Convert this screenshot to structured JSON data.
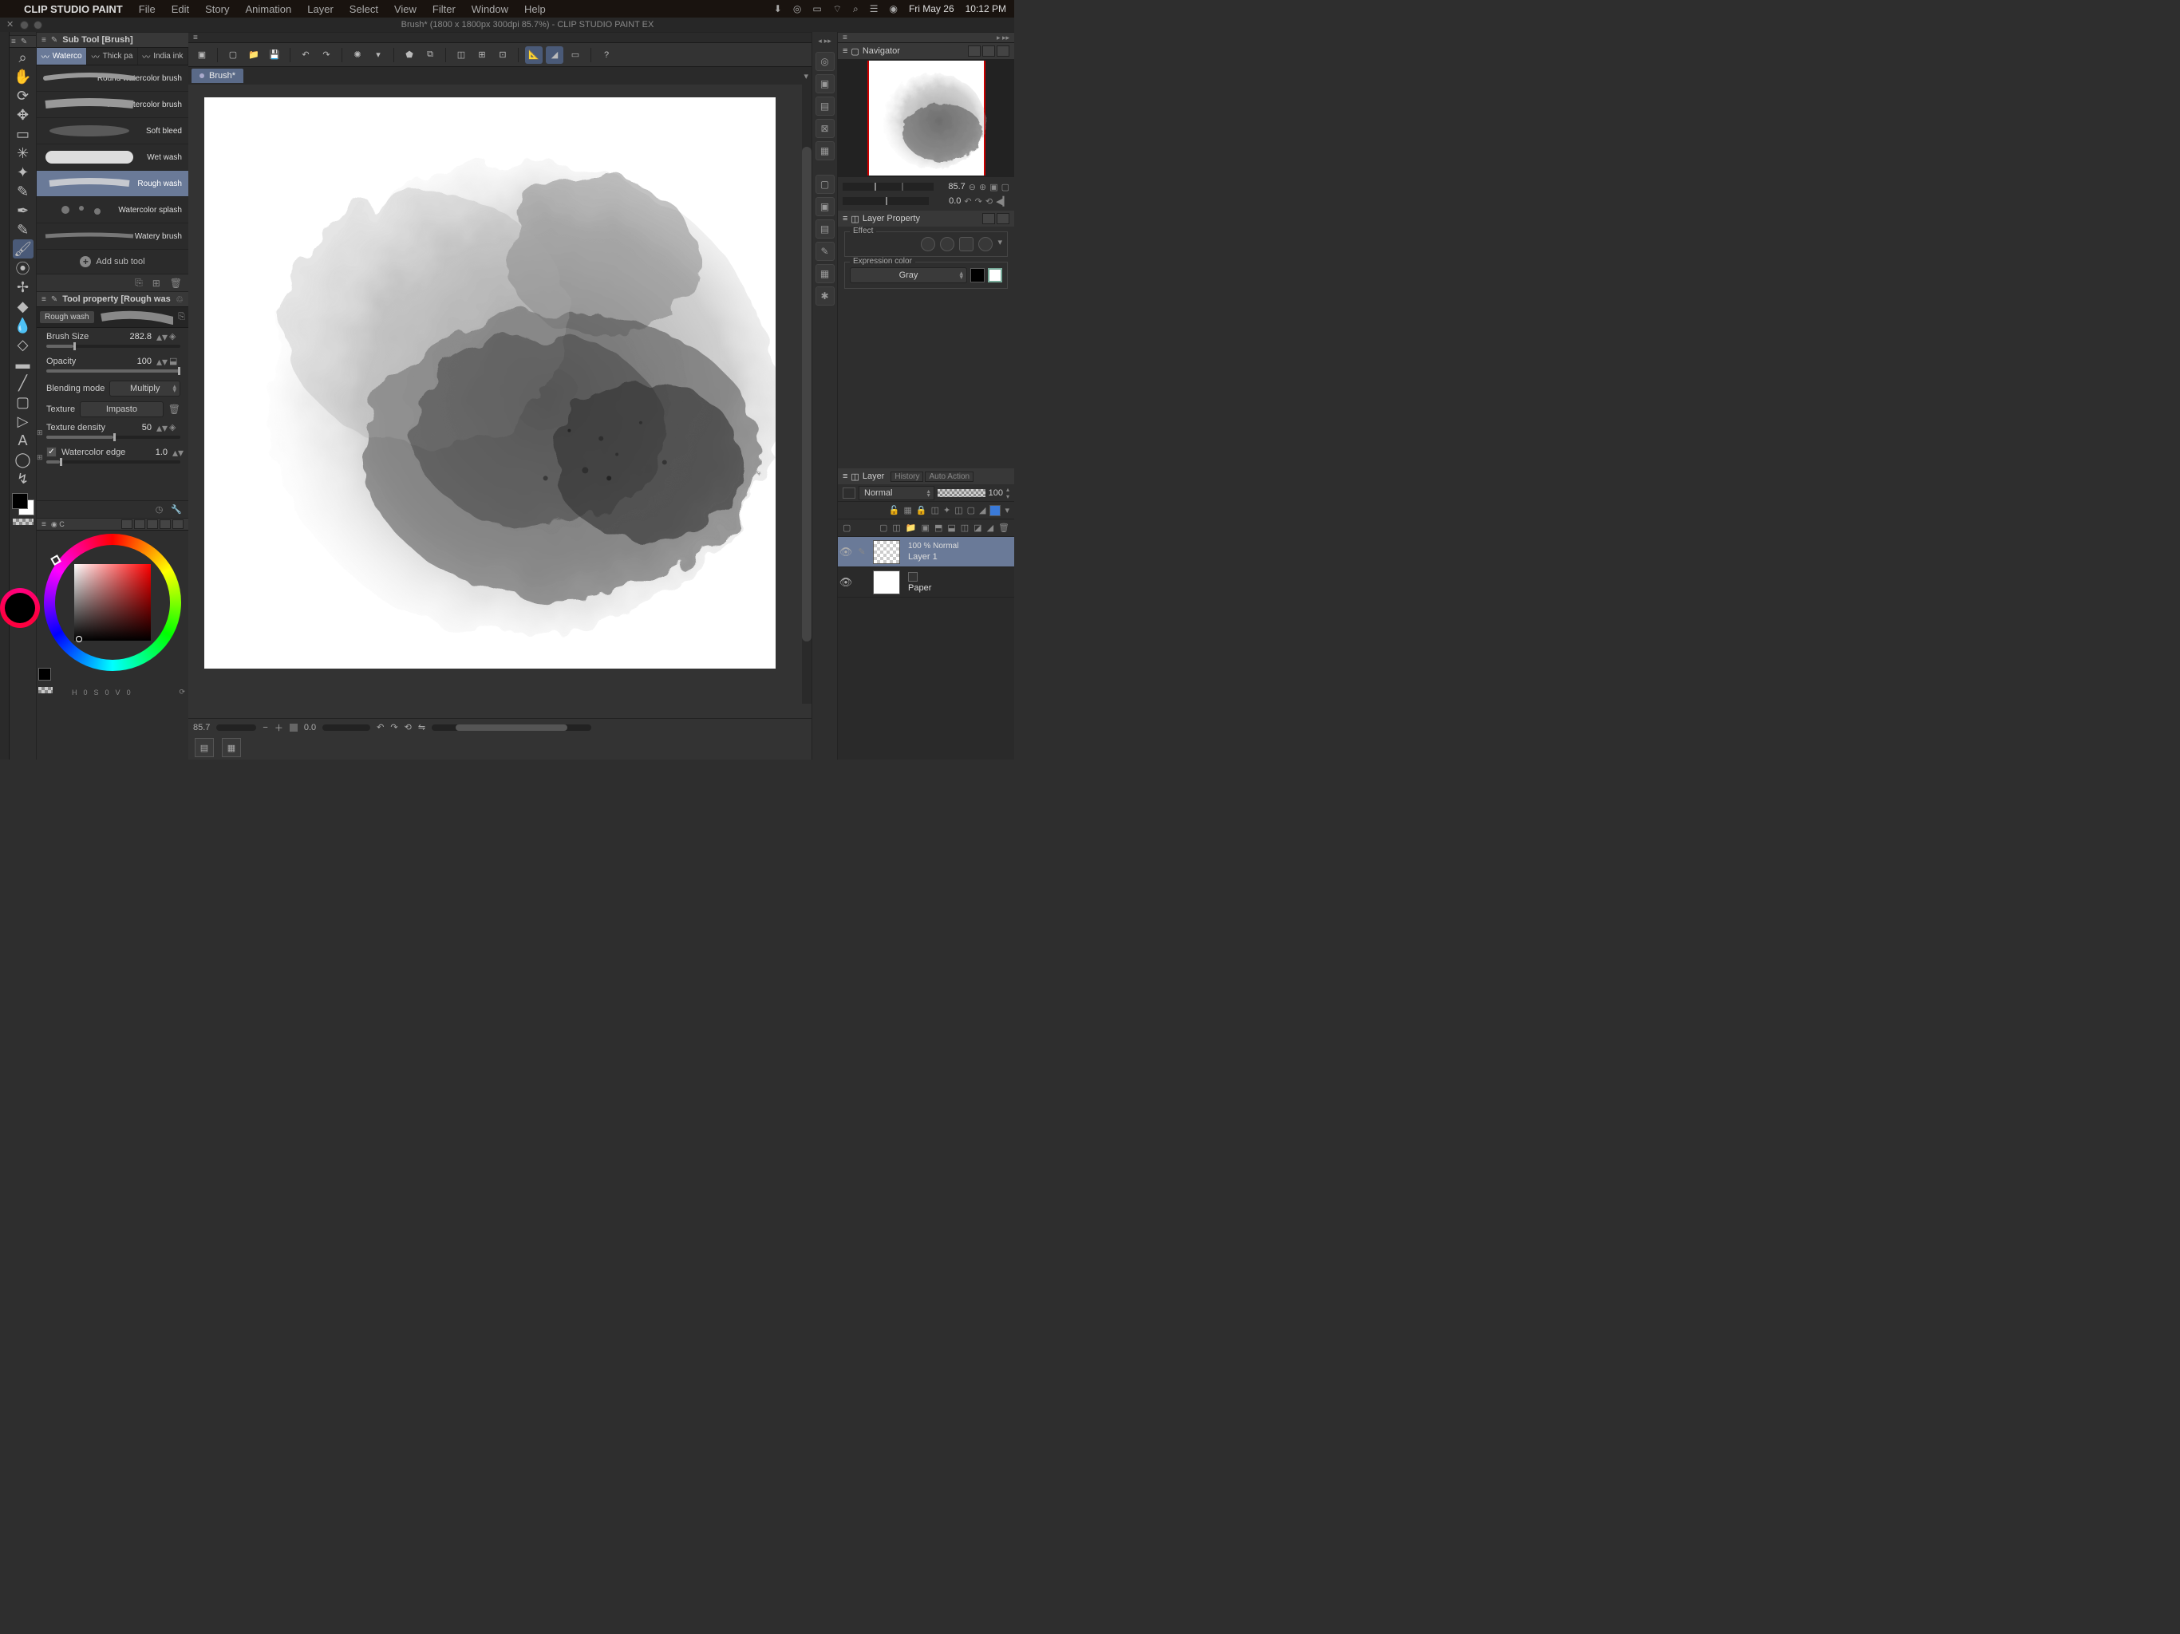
{
  "app_name": "CLIP STUDIO PAINT",
  "menu": [
    "File",
    "Edit",
    "Story",
    "Animation",
    "Layer",
    "Select",
    "View",
    "Filter",
    "Window",
    "Help"
  ],
  "status_date": "Fri May 26",
  "status_time": "10:12 PM",
  "window_title": "Brush* (1800 x 1800px 300dpi 85.7%)  -  CLIP STUDIO PAINT EX",
  "subtool": {
    "panel_title": "Sub Tool [Brush]",
    "tabs": [
      "Waterco",
      "Thick pa",
      "India ink"
    ],
    "selected_tab": 0,
    "brushes": [
      "Round watercolor brush",
      "Flat watercolor brush",
      "Soft bleed",
      "Wet wash",
      "Rough wash",
      "Watercolor splash",
      "Watery brush"
    ],
    "selected_brush": 4,
    "add_label": "Add sub tool"
  },
  "toolprop": {
    "panel_title": "Tool property [Rough was",
    "brush_name": "Rough wash",
    "brush_size_label": "Brush Size",
    "brush_size_value": "282.8",
    "opacity_label": "Opacity",
    "opacity_value": "100",
    "blending_label": "Blending mode",
    "blending_value": "Multiply",
    "texture_label": "Texture",
    "texture_value": "Impasto",
    "texdensity_label": "Texture density",
    "texdensity_value": "50",
    "edge_label": "Watercolor edge",
    "edge_value": "1.0"
  },
  "color": {
    "h_label": "H",
    "h_val": "0",
    "s_label": "S",
    "s_val": "0",
    "v_label": "V",
    "v_val": "0"
  },
  "doc_tab": "Brush*",
  "canvas_zoom": "85.7",
  "canvas_rot": "0.0",
  "navigator": {
    "title": "Navigator",
    "zoom": "85.7",
    "rot": "0.0"
  },
  "layer_property": {
    "title": "Layer Property",
    "effect_label": "Effect",
    "expr_label": "Expression color",
    "expr_value": "Gray"
  },
  "layer_panel": {
    "title": "Layer",
    "tabs": [
      "History",
      "Auto Action"
    ],
    "blend": "Normal",
    "opacity": "100",
    "layers": [
      {
        "opacity_mode": "100 %  Normal",
        "name": "Layer 1",
        "selected": true,
        "trans": true
      },
      {
        "opacity_mode": "",
        "name": "Paper",
        "selected": false,
        "trans": false
      }
    ]
  }
}
